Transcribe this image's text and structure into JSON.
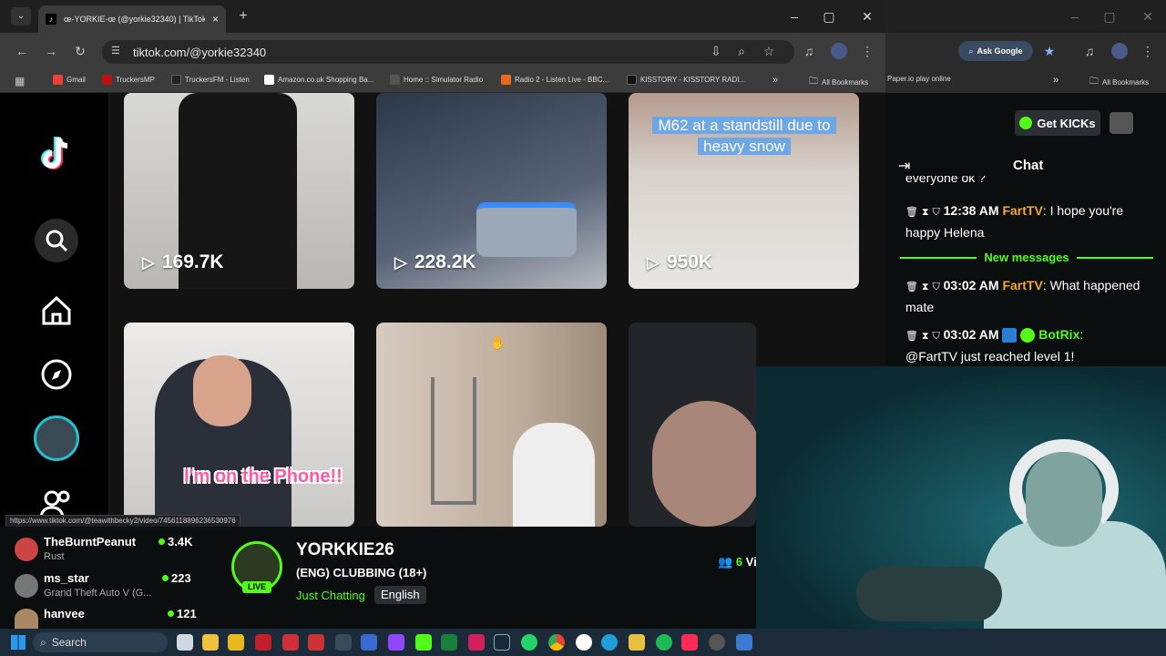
{
  "browser": {
    "tab_title": "œ-YORKIE-œ (@yorkie32340) | TikTok",
    "url": "tiktok.com/@yorkie32340",
    "right_button": "Ask Google",
    "bookmarks": [
      "Gmail",
      "TruckersMP",
      "TruckersFM - Listen",
      "Amazon.co.uk Shopping Ba...",
      "Home :: Simulator Radio",
      "Radio 2 - Listen Live - BBC...",
      "KISSTORY - KISSTORY RADI..."
    ],
    "all_bookmarks": "All Bookmarks",
    "right_bookmark": "Paper.io play online",
    "status_url": "https://www.tiktok.com/@teawithbecky2/video/7456118896236530976"
  },
  "tiktok": {
    "videos": [
      {
        "views": "169.7K",
        "overlay": ""
      },
      {
        "views": "228.2K",
        "overlay": ""
      },
      {
        "views": "950K",
        "overlay": "M62 at a standstill due to heavy snow"
      },
      {
        "views": "",
        "overlay": "I'm on the Phone!!"
      },
      {
        "views": "",
        "overlay": ""
      },
      {
        "views": "",
        "overlay": ""
      }
    ]
  },
  "kick": {
    "get_kicks": "Get KICKs",
    "chat_title": "Chat",
    "partial_line": "everyone ok ?",
    "messages": [
      {
        "time": "12:38 AM",
        "user": "FartTV",
        "text": ": I hope you're happy Helena"
      },
      {
        "time": "03:02 AM",
        "user": "FartTV",
        "text": ": What happened mate"
      },
      {
        "time": "03:02 AM",
        "user": "BotRix",
        "text": ":"
      }
    ],
    "botrix_msg": "@FartTV just reached level 1!",
    "new_messages": "New messages",
    "channels": [
      {
        "name": "TheBurntPeanut",
        "sub": "Rust",
        "count": "3.4K"
      },
      {
        "name": "ms_star",
        "sub": "Grand Theft Auto V (G...",
        "count": "223"
      },
      {
        "name": "hanvee",
        "sub": "",
        "count": "121"
      }
    ],
    "streamer": {
      "name": "YORKKIE26",
      "title": "(ENG) CLUBBING (18+)",
      "category": "Just Chatting",
      "language": "English",
      "live": "LIVE",
      "viewers": "6",
      "viewers_suffix": "Vi"
    }
  },
  "taskbar": {
    "search": "Search"
  },
  "colors": {
    "kick_green": "#53fc18",
    "tiktok_bg": "#121212",
    "chat_bg": "#0b0e0f"
  }
}
